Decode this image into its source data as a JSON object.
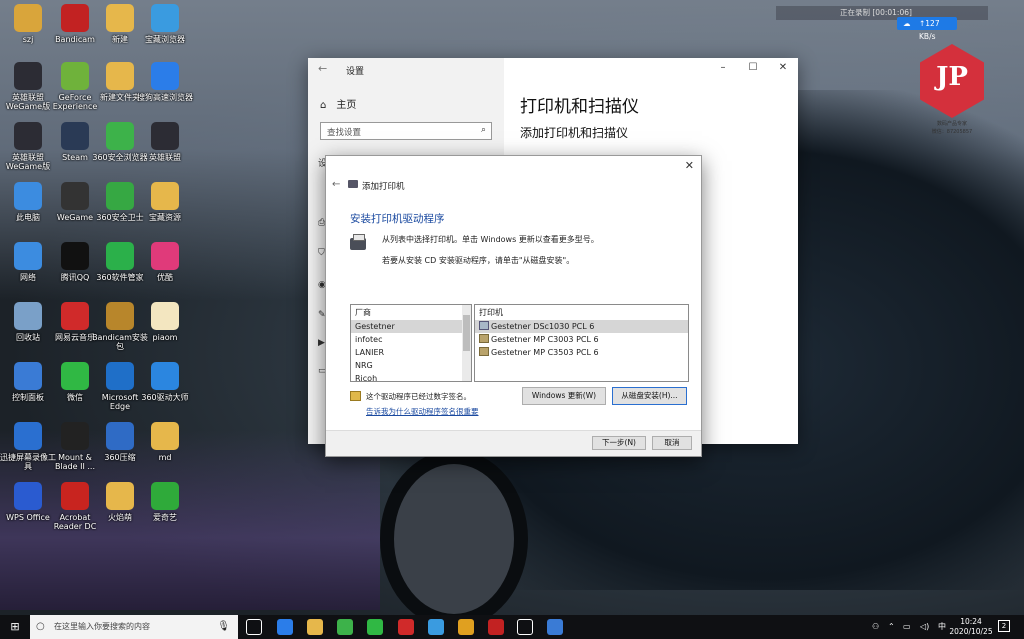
{
  "desktop_icons": [
    {
      "label": "szj",
      "color": "#d9a53b"
    },
    {
      "label": "Bandicam",
      "color": "#c22222"
    },
    {
      "label": "新建",
      "color": "#e6b74b"
    },
    {
      "label": "宝藏浏览器",
      "color": "#3a9be0"
    },
    {
      "label": "英雄联盟WeGame版",
      "color": "#2c2c34"
    },
    {
      "label": "GeForce Experience",
      "color": "#6fb23b"
    },
    {
      "label": "新建文件夹",
      "color": "#e6b74b"
    },
    {
      "label": "搜狗高速浏览器",
      "color": "#2b7de9"
    },
    {
      "label": "英雄联盟WeGame版",
      "color": "#2c2c34"
    },
    {
      "label": "Steam",
      "color": "#2a3a55"
    },
    {
      "label": "360安全浏览器",
      "color": "#3db24a"
    },
    {
      "label": "英雄联盟",
      "color": "#2c2c34"
    },
    {
      "label": "此电脑",
      "color": "#3c8ce0"
    },
    {
      "label": "WeGame",
      "color": "#333333"
    },
    {
      "label": "360安全卫士",
      "color": "#36a843"
    },
    {
      "label": "宝藏资源",
      "color": "#e6b74b"
    },
    {
      "label": "网络",
      "color": "#3c8ce0"
    },
    {
      "label": "腾讯QQ",
      "color": "#111111"
    },
    {
      "label": "360软件管家",
      "color": "#2bb04a"
    },
    {
      "label": "优酷",
      "color": "#e03a7a"
    },
    {
      "label": "回收站",
      "color": "#7aa0c8"
    },
    {
      "label": "网易云音乐",
      "color": "#d02a2a"
    },
    {
      "label": "Bandicam安装包",
      "color": "#b8862b"
    },
    {
      "label": "piaom",
      "color": "#f3e6c0"
    },
    {
      "label": "控制面板",
      "color": "#3a7bd5"
    },
    {
      "label": "微信",
      "color": "#30b844"
    },
    {
      "label": "Microsoft Edge",
      "color": "#1f6fc8"
    },
    {
      "label": "360驱动大师",
      "color": "#2b86e0"
    },
    {
      "label": "迅捷屏幕录像工具",
      "color": "#2a6fd0"
    },
    {
      "label": "Mount & Blade II ...",
      "color": "#222222"
    },
    {
      "label": "360压缩",
      "color": "#2f6bc5"
    },
    {
      "label": "md",
      "color": "#e6b74b"
    },
    {
      "label": "WPS Office",
      "color": "#2a5bd0"
    },
    {
      "label": "Acrobat Reader DC",
      "color": "#c8241f"
    },
    {
      "label": "火焰萌",
      "color": "#e6b74b"
    },
    {
      "label": "爱奇艺",
      "color": "#2faa3a"
    }
  ],
  "recorder": {
    "text": "正在录制 [00:01:06]"
  },
  "speed": {
    "value": "↑127 KB/s"
  },
  "watermark": {
    "logo": "JP",
    "line1": "数码产品专家",
    "line2": "微信：87205857"
  },
  "settings": {
    "title": "设置",
    "home": "主页",
    "search_placeholder": "查找设置",
    "heading": "打印机和扫描仪",
    "subheading": "添加打印机和扫描仪",
    "side_letter": "设"
  },
  "dialog": {
    "title": "添加打印机",
    "heading": "安装打印机驱动程序",
    "line1": "从列表中选择打印机。单击 Windows 更新以查看更多型号。",
    "line2": "若要从安装 CD 安装驱动程序，请单击\"从磁盘安装\"。",
    "manufacturer_header": "厂商",
    "manufacturers": [
      "Gestetner",
      "infotec",
      "LANIER",
      "NRG",
      "Ricoh"
    ],
    "selected_manufacturer": 0,
    "printer_header": "打印机",
    "printers": [
      "Gestetner DSc1030 PCL 6",
      "Gestetner MP C3003 PCL 6",
      "Gestetner MP C3503 PCL 6"
    ],
    "selected_printer": 0,
    "signed_text": "这个驱动程序已经过数字签名。",
    "signed_link": "告诉我为什么驱动程序签名很重要",
    "windows_update_button": "Windows 更新(W)",
    "have_disk_button": "从磁盘安装(H)...",
    "next_button": "下一步(N)",
    "cancel_button": "取消"
  },
  "taskbar": {
    "search_placeholder": "在这里输入你要搜索的内容",
    "ime": "中",
    "time": "10:24",
    "date": "2020/10/25",
    "notifications": "2",
    "apps": [
      {
        "name": "task-view",
        "color": "#ffffff"
      },
      {
        "name": "sogou-browser",
        "color": "#2b7de9"
      },
      {
        "name": "file-explorer",
        "color": "#e6b74b"
      },
      {
        "name": "360-browser",
        "color": "#3db24a"
      },
      {
        "name": "wechat",
        "color": "#30b844"
      },
      {
        "name": "netease-music",
        "color": "#d02a2a"
      },
      {
        "name": "baidu-netdisk",
        "color": "#3a9be0"
      },
      {
        "name": "g-app",
        "color": "#e0a020"
      },
      {
        "name": "bandicam",
        "color": "#c22222"
      },
      {
        "name": "settings",
        "color": "#ffffff"
      },
      {
        "name": "control-panel",
        "color": "#3a7bd5"
      }
    ]
  },
  "colors": {
    "accent": "#1b4aa0",
    "taskbar": "#0f1013",
    "dialog_bottom": "#f0f0f0"
  }
}
